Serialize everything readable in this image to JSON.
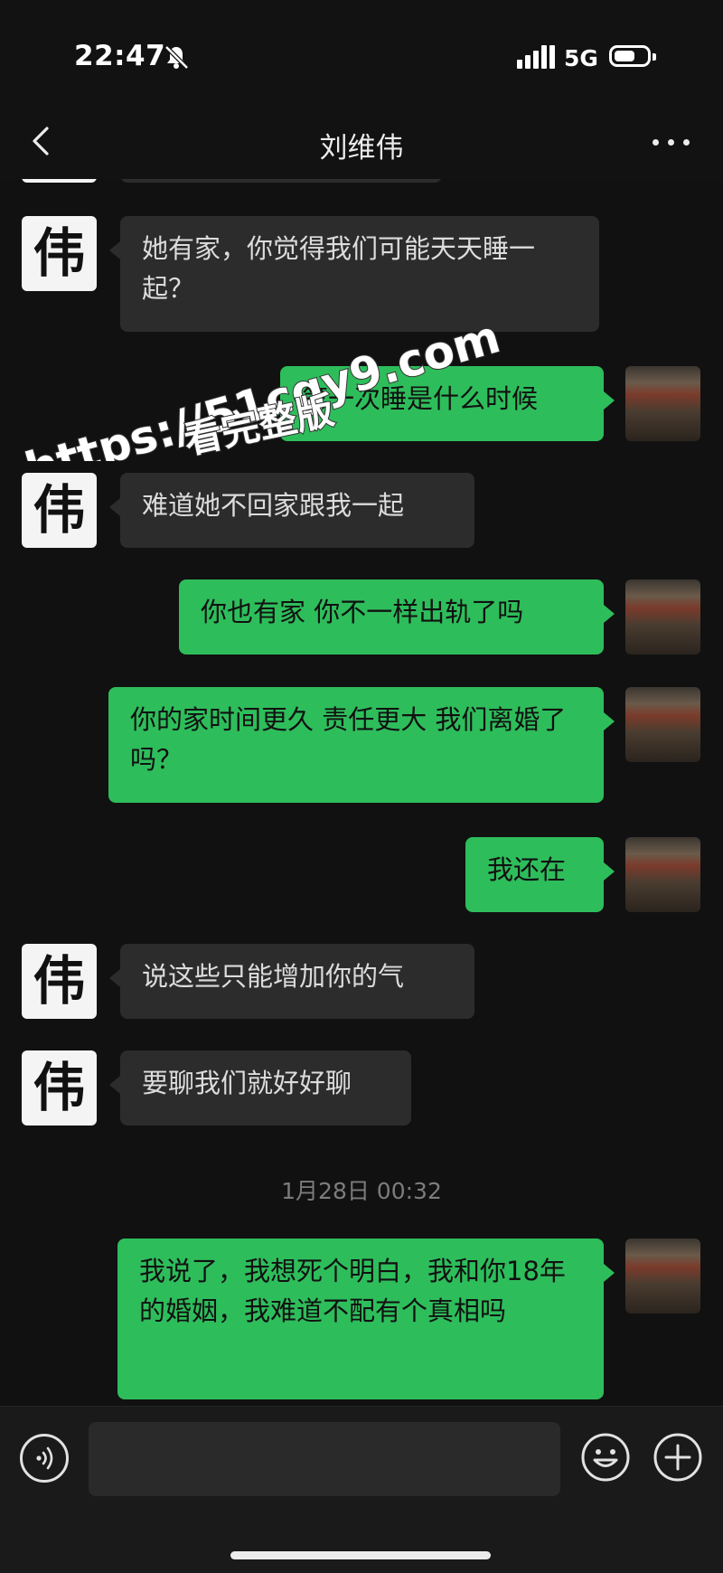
{
  "status_bar": {
    "time": "22:47",
    "network": "5G",
    "icons": [
      "bell-off-icon",
      "signal-icon",
      "battery-icon"
    ]
  },
  "header": {
    "title": "刘维伟",
    "back_icon": "chevron-left-icon",
    "more_icon": "more-dots-icon"
  },
  "contact_avatar_text": "伟",
  "messages": [
    {
      "side": "in",
      "text": "她有家，你觉得我们可能天天睡一起？"
    },
    {
      "side": "out",
      "text": "第一次睡是什么时候"
    },
    {
      "side": "in",
      "text": "难道她不回家跟我一起"
    },
    {
      "side": "out",
      "text": "你也有家 你不一样出轨了吗"
    },
    {
      "side": "out",
      "text": "你的家时间更久 责任更大 我们离婚了吗？"
    },
    {
      "side": "out",
      "text": "我还在"
    },
    {
      "side": "in",
      "text": "说这些只能增加你的气"
    },
    {
      "side": "in",
      "text": "要聊我们就好好聊"
    },
    {
      "side": "out",
      "text": "我说了，我想死个明白，我和你18年的婚姻，我难道不配有个真相吗"
    }
  ],
  "timestamp": "1月28日 00:32",
  "watermark": {
    "line1": "https://51cgy9.com",
    "line2": "看完整版"
  },
  "input_bar": {
    "placeholder": "",
    "icons": [
      "voice-icon",
      "emoji-icon",
      "plus-icon"
    ]
  },
  "colors": {
    "background": "#111111",
    "incoming_bubble": "#2c2c2c",
    "outgoing_bubble": "#2ebd5b"
  }
}
